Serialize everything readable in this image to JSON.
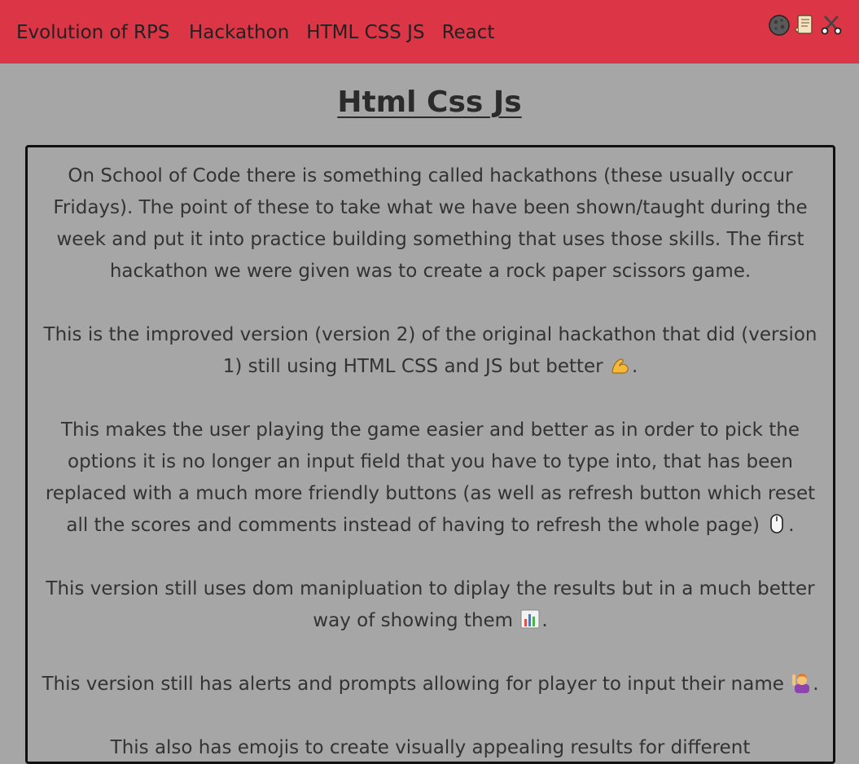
{
  "navbar": {
    "brand": "Evolution of RPS",
    "links": [
      "Hackathon",
      "HTML CSS JS",
      "React"
    ],
    "icons": [
      "rock-icon",
      "paper-scroll-icon",
      "scissors-icon"
    ],
    "background": "#dc3545"
  },
  "page": {
    "title": "Html Css Js"
  },
  "content": {
    "paragraphs": [
      "On School of Code there is something called hackathons (these usually occur Fridays). The point of these to take what we have been shown/taught during the week and put it into practice building something that uses those skills. The first hackathon we were given was to create a rock paper scissors game.",
      "This is the improved version (version 2) of the original hackathon that did (version 1) still using HTML CSS and JS but better",
      "This makes the user playing the game easier and better as in order to pick the options it is no longer an input field that you have to type into, that has been replaced with a much more friendly buttons (as well as refresh button which reset all the scores and comments instead of having to refresh the whole page)",
      "This version still uses dom manipluation to diplay the results but in a much better way of showing them",
      "This version still has alerts and prompts allowing for player to input their name",
      "This also has emojis to create visually appealing results for different"
    ],
    "paragraph_emojis": [
      "",
      "flexed-biceps-icon",
      "computer-mouse-icon",
      "bar-chart-icon",
      "person-raising-hand-icon",
      ""
    ]
  }
}
